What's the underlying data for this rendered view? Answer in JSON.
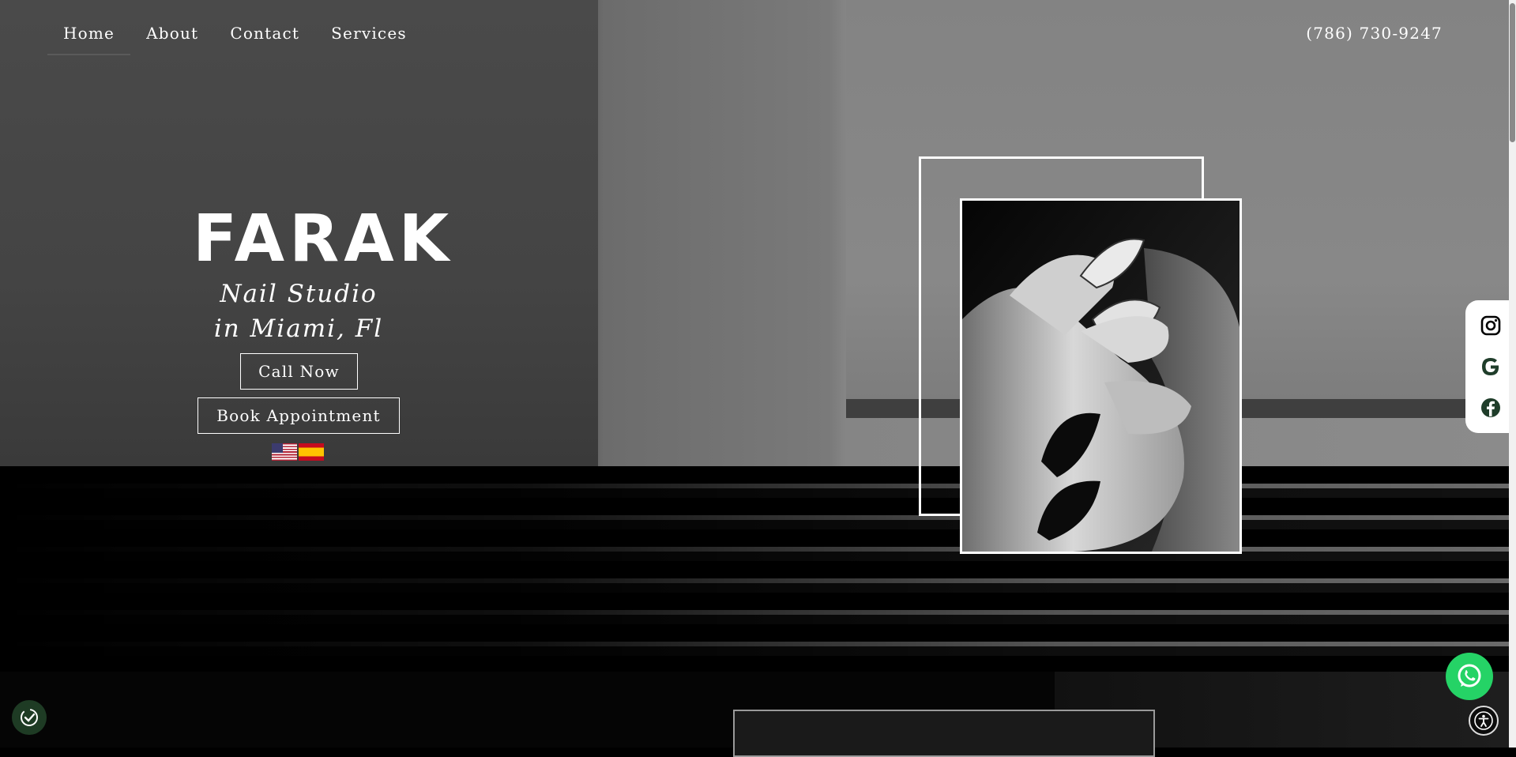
{
  "nav": {
    "items": [
      {
        "label": "Home"
      },
      {
        "label": "About"
      },
      {
        "label": "Contact"
      },
      {
        "label": "Services"
      }
    ],
    "phone": "(786) 730-9247"
  },
  "hero": {
    "logo": "FARAK",
    "tagline_line1": "Nail Studio",
    "tagline_line2": "in Miami, Fl",
    "call_button": "Call Now",
    "book_button": "Book Appointment",
    "languages": [
      "us-flag-icon",
      "spain-flag-icon"
    ]
  },
  "social": [
    "instagram-icon",
    "google-icon",
    "facebook-icon"
  ],
  "colors": {
    "whatsapp": "#25d366",
    "cookie_badge": "#1e3b24",
    "text": "#ffffff"
  }
}
